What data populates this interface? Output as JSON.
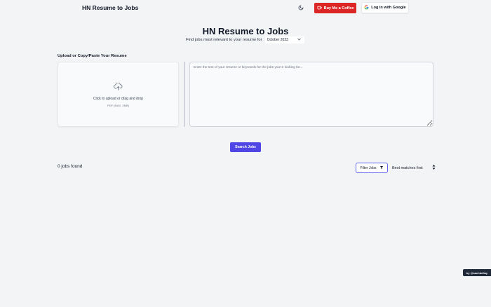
{
  "header": {
    "brand": "HN Resume to Jobs",
    "theme_toggle_icon": "moon-icon",
    "coffee_label": "Buy Me a Coffee",
    "coffee_color": "#dc2626",
    "google_label": "Log in with Google"
  },
  "hero": {
    "title": "HN Resume to Jobs",
    "subtitle": "Find jobs most relevant to your resume for",
    "selected_month": "October 2023"
  },
  "upload": {
    "section_label": "Upload or Copy/Paste Your Resume",
    "icon": "cloud-upload-icon",
    "prompt": "Click to upload or drag and drop",
    "hint": "PDF (MAX. 2MB)"
  },
  "resume_input": {
    "placeholder": "Enter the text of your resume or keywords for the jobs you're looking for...",
    "value": ""
  },
  "search": {
    "label": "Search Jobs",
    "color": "#4f46e5"
  },
  "results": {
    "count_text": "0 jobs found",
    "filter_label": "Filter Jobs",
    "filter_icon": "funnel-icon",
    "sort_selected": "Best matches first"
  },
  "credit": {
    "text": "by @sachbellay"
  }
}
